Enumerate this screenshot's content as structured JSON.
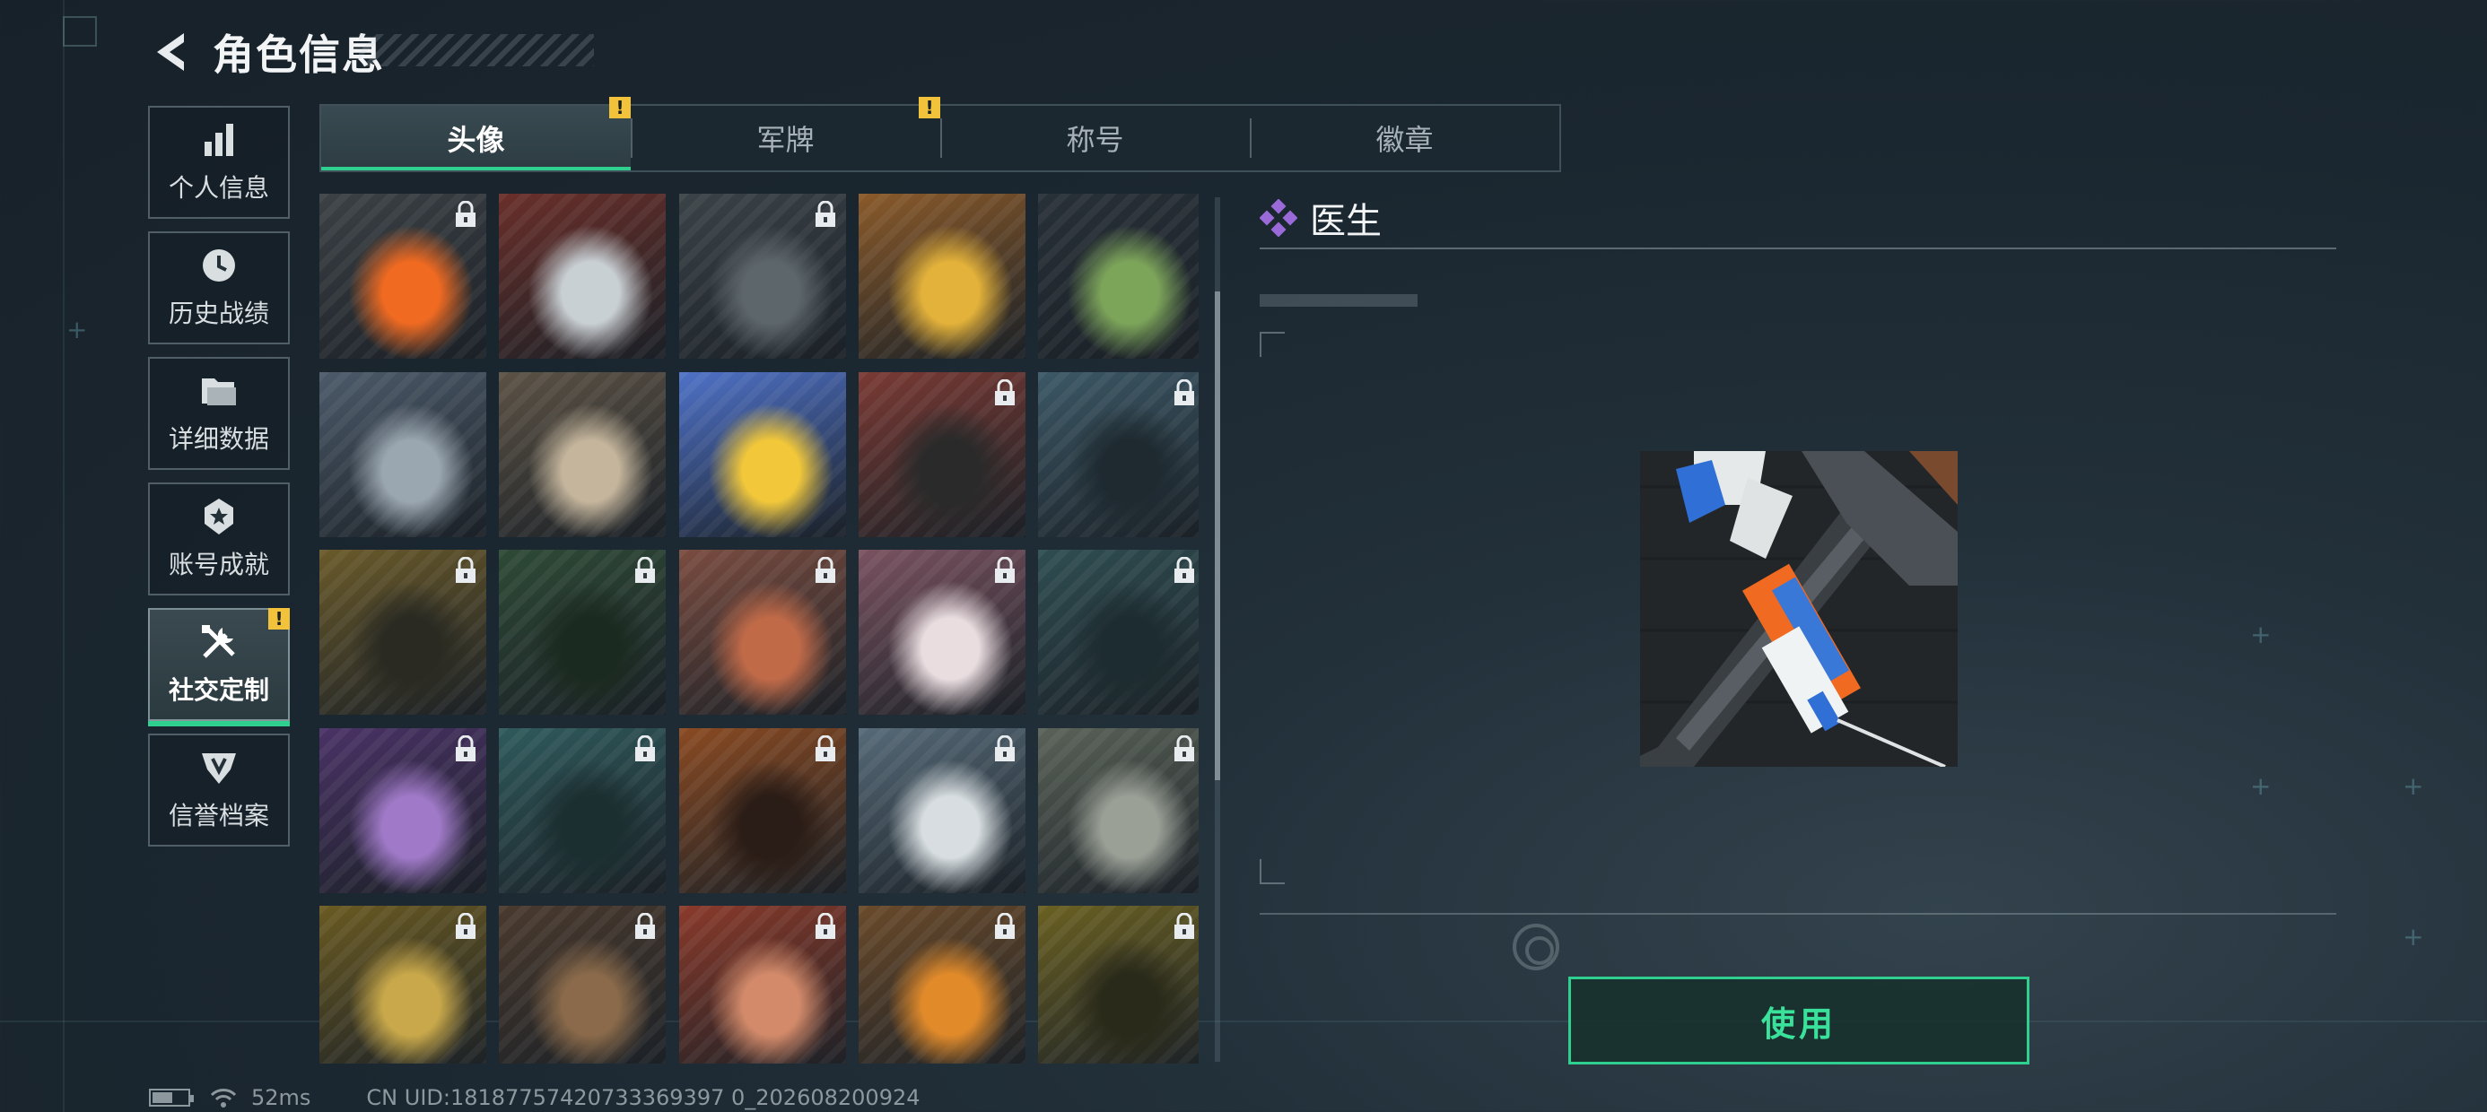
{
  "header": {
    "title": "角色信息",
    "back_icon": "back-arrow-icon"
  },
  "side_menu": [
    {
      "label": "个人信息",
      "icon": "bar-chart-icon",
      "active": false,
      "alert": false
    },
    {
      "label": "历史战绩",
      "icon": "clock-icon",
      "active": false,
      "alert": false
    },
    {
      "label": "详细数据",
      "icon": "folder-icon",
      "active": false,
      "alert": false
    },
    {
      "label": "账号成就",
      "icon": "badge-icon",
      "active": false,
      "alert": false
    },
    {
      "label": "社交定制",
      "icon": "tools-icon",
      "active": true,
      "alert": true
    },
    {
      "label": "信誉档案",
      "icon": "shield-icon",
      "active": false,
      "alert": false
    }
  ],
  "tabs": [
    {
      "label": "头像",
      "active": true,
      "alert": true
    },
    {
      "label": "军牌",
      "active": false,
      "alert": true
    },
    {
      "label": "称号",
      "active": false,
      "alert": false
    },
    {
      "label": "徽章",
      "active": false,
      "alert": false
    }
  ],
  "alert_mark": "!",
  "avatars": [
    {
      "name": "avatar-syringe-gun",
      "locked": true,
      "selected": true
    },
    {
      "name": "avatar-number-6-shield",
      "locked": false
    },
    {
      "name": "avatar-tower",
      "locked": true
    },
    {
      "name": "avatar-cartoon-crash",
      "locked": false
    },
    {
      "name": "avatar-green-robot",
      "locked": false
    },
    {
      "name": "avatar-soldier-aiming",
      "locked": false
    },
    {
      "name": "avatar-treasure-map",
      "locked": false
    },
    {
      "name": "avatar-yellow-mascot",
      "locked": false
    },
    {
      "name": "avatar-bearded-operator",
      "locked": true
    },
    {
      "name": "avatar-pilot-woman",
      "locked": true
    },
    {
      "name": "avatar-bald-operator",
      "locked": true
    },
    {
      "name": "avatar-smiling-man",
      "locked": true
    },
    {
      "name": "avatar-helmet-soldier",
      "locked": true
    },
    {
      "name": "avatar-white-hair-woman",
      "locked": true
    },
    {
      "name": "avatar-glasses-man",
      "locked": true
    },
    {
      "name": "avatar-purple-woman",
      "locked": true
    },
    {
      "name": "avatar-masked-operator",
      "locked": true
    },
    {
      "name": "avatar-scarf-man",
      "locked": true
    },
    {
      "name": "avatar-star-emblem",
      "locked": true
    },
    {
      "name": "avatar-landscape-helicopter",
      "locked": true
    },
    {
      "name": "avatar-mascot-eating",
      "locked": true
    },
    {
      "name": "avatar-scales-emblem",
      "locked": true
    },
    {
      "name": "avatar-red-hair-woman",
      "locked": true
    },
    {
      "name": "avatar-eri-globe",
      "locked": true
    },
    {
      "name": "avatar-curly-hair-man",
      "locked": true
    }
  ],
  "detail": {
    "name": "医生",
    "icon": "purple-diamond-icon",
    "use_label": "使用"
  },
  "status_bar": {
    "ping": "52ms",
    "uid": "CN UID:18187757420733369397 0_202608200924"
  },
  "colors": {
    "accent": "#2fd08f",
    "alert": "#f2c33a",
    "rarity_purple": "#9a6ad8"
  }
}
